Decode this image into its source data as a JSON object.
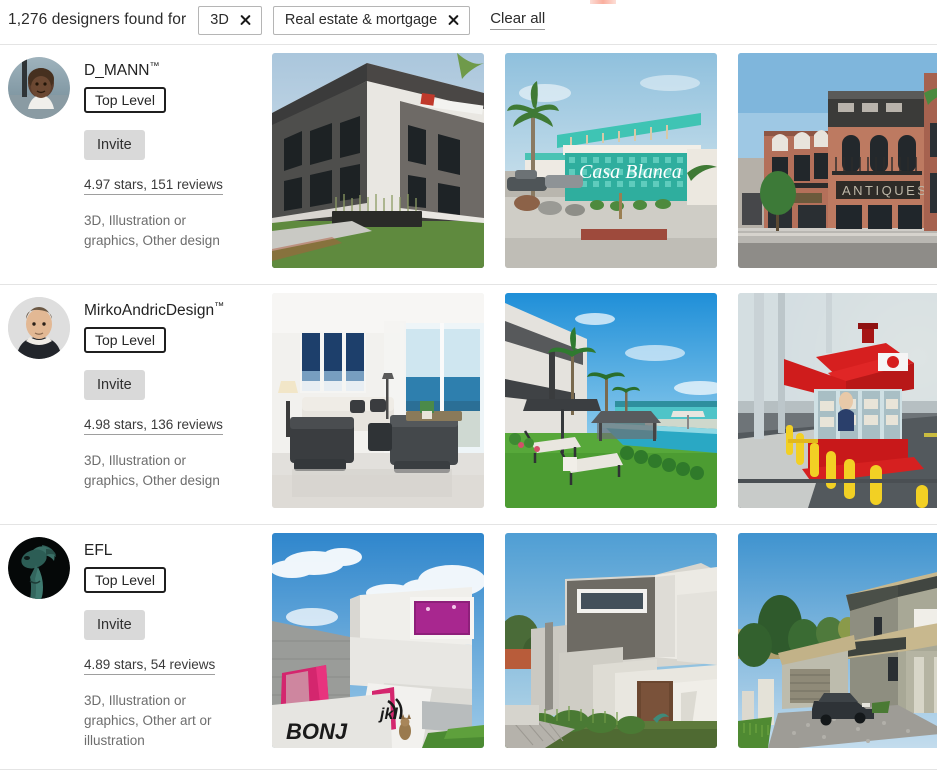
{
  "header": {
    "results_text": "1,276 designers found for",
    "filters": [
      {
        "label": "3D",
        "remove_icon": "close-icon"
      },
      {
        "label": "Real estate & mortgage",
        "remove_icon": "close-icon"
      }
    ],
    "clear_all_label": "Clear all"
  },
  "designers": [
    {
      "name": "D_MANN",
      "trademark": "™",
      "badge": "Top Level",
      "invite_label": "Invite",
      "rating": "4.97 stars, 151 reviews",
      "skills": "3D, Illustration or graphics, Other design",
      "avatar_alt": "designer-avatar",
      "portfolio": [
        {
          "alt": "two-story-office-building-exterior-render"
        },
        {
          "alt": "casa-blanca-midcentury-motel-render"
        },
        {
          "alt": "brick-antiques-storefront-street-render"
        }
      ]
    },
    {
      "name": "MirkoAndricDesign",
      "trademark": "™",
      "badge": "Top Level",
      "invite_label": "Invite",
      "rating": "4.98 stars, 136 reviews",
      "skills": "3D, Illustration or graphics, Other design",
      "avatar_alt": "designer-avatar",
      "portfolio": [
        {
          "alt": "modern-living-room-ocean-view-render"
        },
        {
          "alt": "beachfront-villa-lawn-pool-render"
        },
        {
          "alt": "red-roadside-kiosk-render"
        }
      ]
    },
    {
      "name": "EFL",
      "trademark": "",
      "badge": "Top Level",
      "invite_label": "Invite",
      "rating": "4.89 stars, 54 reviews",
      "skills": "3D, Illustration or graphics, Other art or illustration",
      "avatar_alt": "designer-avatar",
      "portfolio": [
        {
          "alt": "white-concrete-house-magenta-window-render"
        },
        {
          "alt": "modern-grey-house-strip-window-render"
        },
        {
          "alt": "hillside-house-driveway-car-render"
        }
      ]
    }
  ],
  "colors": {
    "chip_border": "#b5b5b5",
    "invite_bg": "#d9d9d9",
    "divider": "#e4e4e4",
    "text_primary": "#222222",
    "text_muted": "#6d6d6d"
  }
}
